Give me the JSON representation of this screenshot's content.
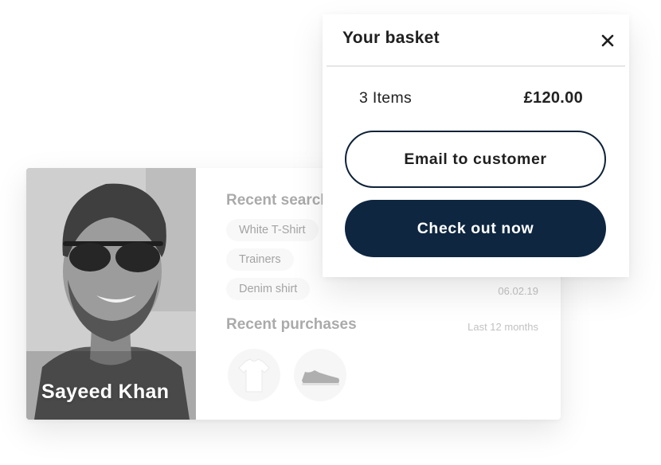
{
  "customer": {
    "name": "Sayeed Khan",
    "recent_searches": {
      "title": "Recent searches",
      "items": [
        "White T-Shirt",
        "Trainers",
        "Denim shirt"
      ],
      "date": "06.02.19"
    },
    "recent_purchases": {
      "title": "Recent purchases",
      "period": "Last 12 months",
      "products": [
        {
          "icon": "t-shirt-icon"
        },
        {
          "icon": "sneaker-icon"
        }
      ]
    }
  },
  "basket": {
    "title": "Your basket",
    "close_icon": "close-icon",
    "item_count": "3 Items",
    "total": "£120.00",
    "email_button": "Email to customer",
    "checkout_button": "Check out now",
    "colors": {
      "primary": "#0e2640",
      "outline": "#0e2238"
    }
  }
}
